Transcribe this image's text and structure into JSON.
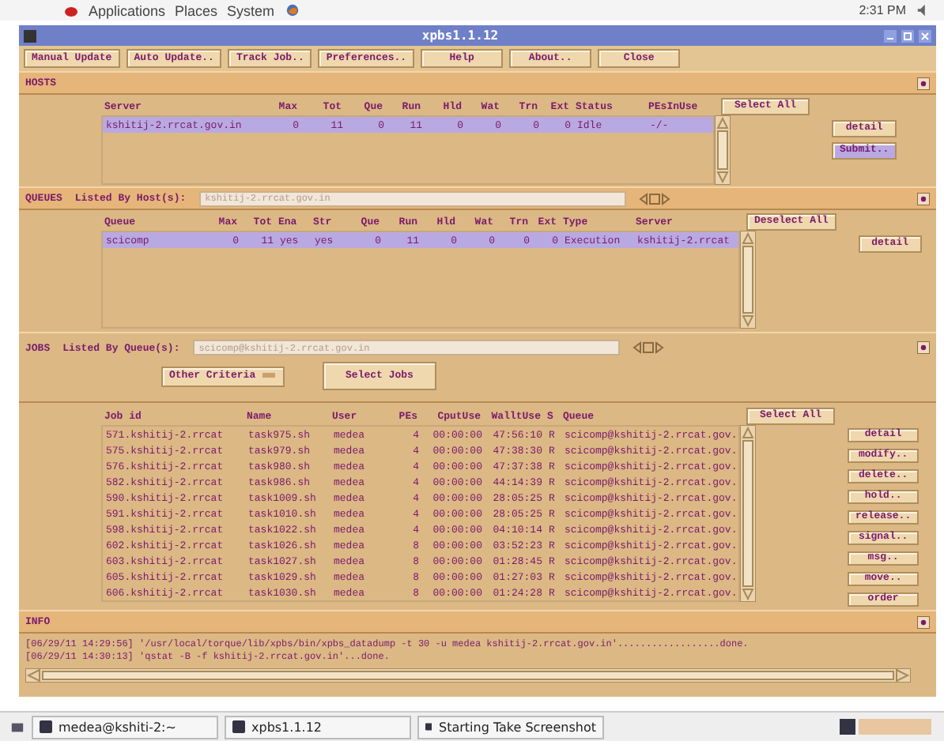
{
  "top_panel": {
    "menus": [
      "Applications",
      "Places",
      "System"
    ],
    "clock": "2:31 PM"
  },
  "window": {
    "title": "xpbs1.1.12"
  },
  "toolbar": [
    "Manual Update",
    "Auto Update..",
    "Track Job..",
    "Preferences..",
    "Help",
    "About..",
    "Close"
  ],
  "hosts": {
    "title": "HOSTS",
    "columns": [
      "Server",
      "Max",
      "Tot",
      "Que",
      "Run",
      "Hld",
      "Wat",
      "Trn",
      "Ext",
      "Status",
      "PEsInUse"
    ],
    "rows": [
      {
        "selected": true,
        "cells": [
          "kshitij-2.rrcat.gov.in",
          "0",
          "11",
          "0",
          "11",
          "0",
          "0",
          "0",
          "0",
          "Idle",
          "-/-"
        ]
      }
    ],
    "select_all": "Select All",
    "buttons": [
      {
        "label": "detail",
        "focused": false
      },
      {
        "label": "Submit..",
        "focused": true
      }
    ]
  },
  "queues": {
    "title": "QUEUES",
    "filter_label": "Listed By Host(s):",
    "filter_value": "kshitij-2.rrcat.gov.in",
    "columns": [
      "Queue",
      "Max",
      "Tot",
      "Ena",
      "Str",
      "Que",
      "Run",
      "Hld",
      "Wat",
      "Trn",
      "Ext",
      "Type",
      "Server"
    ],
    "rows": [
      {
        "selected": true,
        "cells": [
          "scicomp",
          "0",
          "11",
          "yes",
          "yes",
          "0",
          "11",
          "0",
          "0",
          "0",
          "0",
          "Execution",
          "kshitij-2.rrcat"
        ]
      }
    ],
    "select_all": "Deselect All",
    "buttons": [
      {
        "label": "detail",
        "focused": false
      }
    ]
  },
  "jobs": {
    "title": "JOBS",
    "filter_label": "Listed By Queue(s):",
    "filter_value": "scicomp@kshitij-2.rrcat.gov.in",
    "criteria": "Other Criteria",
    "select_jobs": "Select Jobs",
    "columns": [
      "Job id",
      "Name",
      "User",
      "PEs",
      "CputUse",
      "WalltUse",
      "S",
      "Queue"
    ],
    "rows": [
      {
        "selected": false,
        "cells": [
          "571.kshitij-2.rrcat",
          "task975.sh",
          "medea",
          "4",
          "00:00:00",
          "47:56:10",
          "R",
          "scicomp@kshitij-2.rrcat.gov."
        ]
      },
      {
        "selected": false,
        "cells": [
          "575.kshitij-2.rrcat",
          "task979.sh",
          "medea",
          "4",
          "00:00:00",
          "47:38:30",
          "R",
          "scicomp@kshitij-2.rrcat.gov."
        ]
      },
      {
        "selected": false,
        "cells": [
          "576.kshitij-2.rrcat",
          "task980.sh",
          "medea",
          "4",
          "00:00:00",
          "47:37:38",
          "R",
          "scicomp@kshitij-2.rrcat.gov."
        ]
      },
      {
        "selected": false,
        "cells": [
          "582.kshitij-2.rrcat",
          "task986.sh",
          "medea",
          "4",
          "00:00:00",
          "44:14:39",
          "R",
          "scicomp@kshitij-2.rrcat.gov."
        ]
      },
      {
        "selected": false,
        "cells": [
          "590.kshitij-2.rrcat",
          "task1009.sh",
          "medea",
          "4",
          "00:00:00",
          "28:05:25",
          "R",
          "scicomp@kshitij-2.rrcat.gov."
        ]
      },
      {
        "selected": false,
        "cells": [
          "591.kshitij-2.rrcat",
          "task1010.sh",
          "medea",
          "4",
          "00:00:00",
          "28:05:25",
          "R",
          "scicomp@kshitij-2.rrcat.gov."
        ]
      },
      {
        "selected": false,
        "cells": [
          "598.kshitij-2.rrcat",
          "task1022.sh",
          "medea",
          "4",
          "00:00:00",
          "04:10:14",
          "R",
          "scicomp@kshitij-2.rrcat.gov."
        ]
      },
      {
        "selected": false,
        "cells": [
          "602.kshitij-2.rrcat",
          "task1026.sh",
          "medea",
          "8",
          "00:00:00",
          "03:52:23",
          "R",
          "scicomp@kshitij-2.rrcat.gov."
        ]
      },
      {
        "selected": false,
        "cells": [
          "603.kshitij-2.rrcat",
          "task1027.sh",
          "medea",
          "8",
          "00:00:00",
          "01:28:45",
          "R",
          "scicomp@kshitij-2.rrcat.gov."
        ]
      },
      {
        "selected": false,
        "cells": [
          "605.kshitij-2.rrcat",
          "task1029.sh",
          "medea",
          "8",
          "00:00:00",
          "01:27:03",
          "R",
          "scicomp@kshitij-2.rrcat.gov."
        ]
      },
      {
        "selected": false,
        "cells": [
          "606.kshitij-2.rrcat",
          "task1030.sh",
          "medea",
          "8",
          "00:00:00",
          "01:24:28",
          "R",
          "scicomp@kshitij-2.rrcat.gov."
        ]
      }
    ],
    "select_all": "Select All",
    "buttons": [
      {
        "label": "detail",
        "focused": false
      },
      {
        "label": "modify..",
        "focused": false
      },
      {
        "label": "delete..",
        "focused": false
      },
      {
        "label": "hold..",
        "focused": false
      },
      {
        "label": "release..",
        "focused": false
      },
      {
        "label": "signal..",
        "focused": false
      },
      {
        "label": "msg..",
        "focused": false
      },
      {
        "label": "move..",
        "focused": false
      },
      {
        "label": "order",
        "focused": false
      }
    ]
  },
  "info": {
    "title": "INFO",
    "lines": [
      "[06/29/11 14:29:56] '/usr/local/torque/lib/xpbs/bin/xpbs_datadump -t 30 -u medea  kshitij-2.rrcat.gov.in'..................done.",
      "[06/29/11 14:30:13] 'qstat -B -f kshitij-2.rrcat.gov.in'...done."
    ]
  },
  "taskbar": [
    "medea@kshiti-2:~",
    "xpbs1.1.12",
    "Starting Take Screenshot"
  ]
}
